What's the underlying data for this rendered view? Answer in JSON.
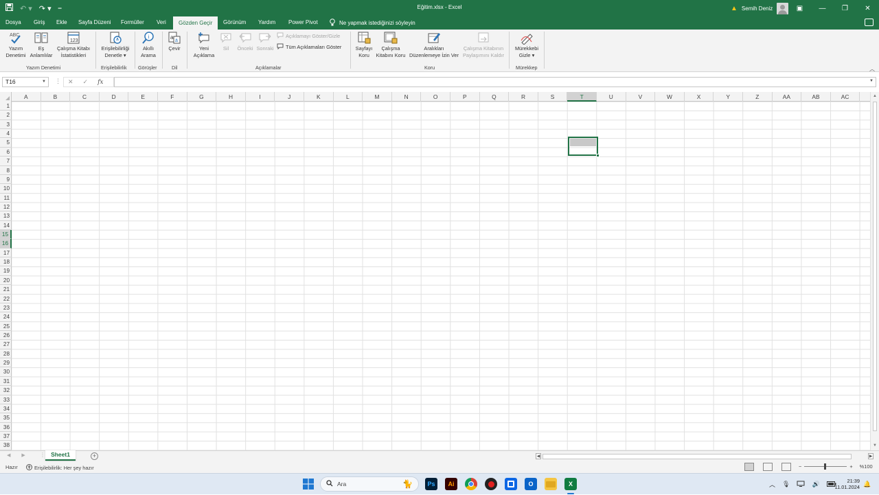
{
  "window": {
    "title": "Eğitim.xlsx  -  Excel",
    "user_name": "Semih Deniz",
    "qat_icons": [
      "save-icon",
      "undo-icon",
      "redo-icon",
      "customize-icon"
    ],
    "window_controls": [
      "ribbon-display-icon",
      "minimize-icon",
      "restore-icon",
      "close-icon"
    ]
  },
  "tabs": [
    {
      "label": "Dosya"
    },
    {
      "label": "Giriş"
    },
    {
      "label": "Ekle"
    },
    {
      "label": "Sayfa Düzeni"
    },
    {
      "label": "Formüller"
    },
    {
      "label": "Veri"
    },
    {
      "label": "Gözden Geçir",
      "active": true
    },
    {
      "label": "Görünüm"
    },
    {
      "label": "Yardım"
    },
    {
      "label": "Power Pivot"
    }
  ],
  "tell_me": "Ne yapmak istediğinizi söyleyin",
  "ribbon": {
    "groups": {
      "proofing": "Yazım Denetimi",
      "accessibility": "Erişilebilirlik",
      "insights": "Görüşler",
      "language": "Dil",
      "comments": "Açıklamalar",
      "protect": "Koru",
      "ink": "Mürekkep"
    },
    "buttons": {
      "spelling": [
        "Yazım",
        "Denetimi"
      ],
      "thesaurus": [
        "Eş",
        "Anlamlılar"
      ],
      "workbook_stats": [
        "Çalışma Kitabı",
        "İstatistikleri"
      ],
      "check_accessibility": [
        "Erişilebilirliği",
        "Denetle ▾"
      ],
      "smart_lookup": [
        "Akıllı",
        "Arama"
      ],
      "translate": [
        "Çevir"
      ],
      "new_comment": [
        "Yeni",
        "Açıklama"
      ],
      "delete": [
        "Sil"
      ],
      "previous": [
        "Önceki"
      ],
      "next": [
        "Sonraki"
      ],
      "show_hide_comment": "Açıklamayı Göster/Gizle",
      "show_all_comments": "Tüm Açıklamaları Göster",
      "protect_sheet": [
        "Sayfayı",
        "Koru"
      ],
      "protect_workbook": [
        "Çalışma",
        "Kitabını Koru"
      ],
      "allow_edit_ranges": [
        "Aralıkları",
        "Düzenlemeye İzin Ver"
      ],
      "unshare_workbook": [
        "Çalışma Kitabının",
        "Paylaşımını Kaldır"
      ],
      "hide_ink": [
        "Mürekkebi",
        "Gizle ▾"
      ],
      "smart_lookup_sub": "Arama"
    }
  },
  "formula_bar": {
    "name_box": "T16",
    "cancel": "✕",
    "enter": "✓",
    "fx": "fx",
    "value": ""
  },
  "sheet": {
    "columns": [
      "A",
      "B",
      "C",
      "D",
      "E",
      "F",
      "G",
      "H",
      "I",
      "J",
      "K",
      "L",
      "M",
      "N",
      "O",
      "P",
      "Q",
      "R",
      "S",
      "T",
      "U",
      "V",
      "W",
      "X",
      "Y",
      "Z",
      "AA",
      "AB",
      "AC"
    ],
    "rows": [
      "1",
      "2",
      "3",
      "4",
      "5",
      "6",
      "7",
      "8",
      "9",
      "10",
      "11",
      "12",
      "13",
      "14",
      "15",
      "16",
      "17",
      "18",
      "19",
      "20",
      "21",
      "22",
      "23",
      "24",
      "25",
      "26",
      "27",
      "28",
      "29",
      "30",
      "31",
      "32",
      "33",
      "34",
      "35",
      "36",
      "37",
      "38"
    ],
    "selected_column": "T",
    "selected_rows": [
      "15",
      "16"
    ],
    "tabs": [
      "Sheet1"
    ],
    "add_sheet": "+"
  },
  "status": {
    "ready": "Hazır",
    "accessibility": "Erişilebilirlik: Her şey hazır",
    "zoom_minus": "−",
    "zoom_plus": "+",
    "zoom_level": "%100",
    "zoom_fraction": 0.47
  },
  "taskbar": {
    "search_placeholder": "Ara",
    "apps": [
      "windows-start-icon",
      "photoshop-icon",
      "illustrator-icon",
      "chrome-icon",
      "record-icon",
      "trello-icon",
      "outlook-icon",
      "file-explorer-icon",
      "excel-icon"
    ],
    "time": "21:39",
    "date": "11.01.2024"
  },
  "colors": {
    "accent": "#217346",
    "ribbon_bg": "#f3f3f3",
    "taskbar_bg": "#dfe8f3"
  }
}
